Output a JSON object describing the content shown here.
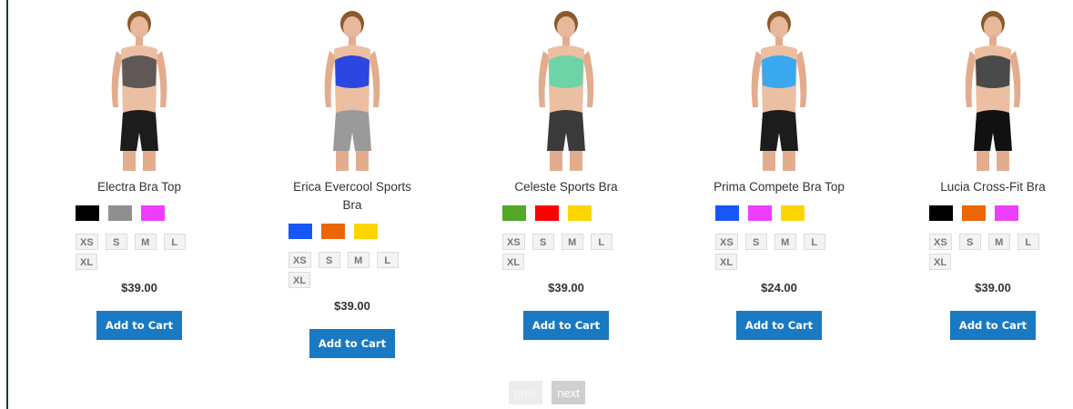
{
  "products": [
    {
      "name": "Electra Bra Top",
      "colors": [
        "#000000",
        "#8f8f8f",
        "#ef3dff"
      ],
      "sizes": [
        "XS",
        "S",
        "M",
        "L",
        "XL"
      ],
      "price": "$39.00",
      "cart_label": "Add to Cart",
      "top_color": "#5e5856",
      "bottom_color": "#1c1c1c"
    },
    {
      "name": "Erica Evercool Sports Bra",
      "colors": [
        "#1857f7",
        "#eb6703",
        "#ffd500"
      ],
      "sizes": [
        "XS",
        "S",
        "M",
        "L",
        "XL"
      ],
      "price": "$39.00",
      "cart_label": "Add to Cart",
      "top_color": "#2c46e0",
      "bottom_color": "#9a9a9a"
    },
    {
      "name": "Celeste Sports Bra",
      "colors": [
        "#53a828",
        "#ff0000",
        "#ffd500"
      ],
      "sizes": [
        "XS",
        "S",
        "M",
        "L",
        "XL"
      ],
      "price": "$39.00",
      "cart_label": "Add to Cart",
      "top_color": "#6fd3a8",
      "bottom_color": "#3a3a3a"
    },
    {
      "name": "Prima Compete Bra Top",
      "colors": [
        "#1857f7",
        "#ef3dff",
        "#ffd500"
      ],
      "sizes": [
        "XS",
        "S",
        "M",
        "L",
        "XL"
      ],
      "price": "$24.00",
      "cart_label": "Add to Cart",
      "top_color": "#3aa8ee",
      "bottom_color": "#1c1c1c"
    },
    {
      "name": "Lucia Cross-Fit Bra",
      "colors": [
        "#000000",
        "#eb6703",
        "#ef3dff"
      ],
      "sizes": [
        "XS",
        "S",
        "M",
        "L",
        "XL"
      ],
      "price": "$39.00",
      "cart_label": "Add to Cart",
      "top_color": "#4a4a4a",
      "bottom_color": "#111111"
    }
  ],
  "pager": {
    "prev_label": "prev",
    "next_label": "next"
  },
  "colors": {
    "accent": "#1979c3",
    "border": "#0f3b35"
  }
}
